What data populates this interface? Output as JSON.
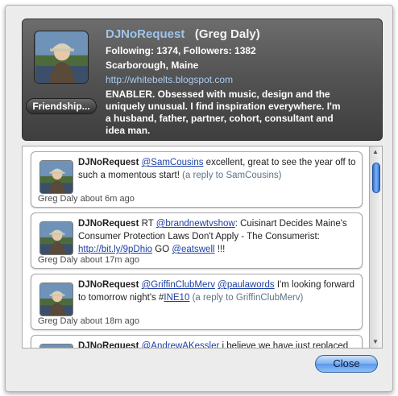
{
  "profile": {
    "screen_name": "DJNoRequest",
    "real_name": "(Greg Daly)",
    "stats": "Following: 1374, Followers: 1382",
    "location": "Scarborough, Maine",
    "url": "http://whitebelts.blogspot.com",
    "bio": "ENABLER. Obsessed with music, design and the uniquely unusual. I find inspiration everywhere. I'm a husband, father, partner, cohort, consultant and idea man.",
    "friendship_button": "Friendship..."
  },
  "tweets": [
    {
      "user": "DJNoRequest",
      "mention": "@SamCousins",
      "text": " excellent, great to see the year off to such a momentous start! ",
      "reply": "(a reply to SamCousins)",
      "meta": "Greg Daly about 6m ago"
    },
    {
      "user": "DJNoRequest",
      "rt": " RT ",
      "mention": "@brandnewtvshow",
      "text": ": Cuisinart Decides Maine's Consumer Protection Laws Don't Apply - The Consumerist: ",
      "link": "http://bit.ly/9pDhio",
      "go": " GO ",
      "mention2": "@eatswell",
      "end": " !!!",
      "meta": "Greg Daly about 17m ago"
    },
    {
      "user": "DJNoRequest",
      "mention": "@GriffinClubMerv",
      "mention2": "@paulawords",
      "text": " I'm looking forward to tomorrow night's #",
      "hashtag": "INE10",
      "reply": "(a reply to GriffinClubMerv)",
      "meta": "Greg Daly about 18m ago"
    },
    {
      "user": "DJNoRequest",
      "mention": "@AndrewAKessler",
      "text": " i believe we have just replaced",
      "meta": ""
    }
  ],
  "close_button": "Close",
  "icons": {
    "avatar": "avatar-photo",
    "scroll_up": "triangle-up-icon",
    "scroll_down": "triangle-down-icon"
  }
}
